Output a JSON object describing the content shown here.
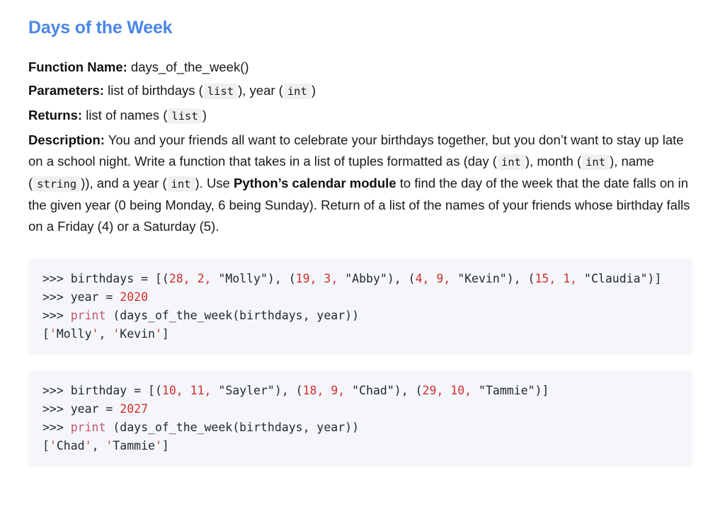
{
  "heading": "Days of the Week",
  "spec": {
    "function_name_label": "Function Name:",
    "function_name_value": "days_of_the_week()",
    "parameters_label": "Parameters:",
    "parameters_text_1": "list of birthdays (",
    "parameters_code_1": "list",
    "parameters_text_2": "), year (",
    "parameters_code_2": "int",
    "parameters_text_3": ")",
    "returns_label": "Returns:",
    "returns_text_1": "list of names (",
    "returns_code_1": "list",
    "returns_text_2": ")"
  },
  "description": {
    "label": "Description:",
    "part_1": "You and your friends all want to celebrate your birthdays together, but you don’t want to stay up late on a school night. Write a function that takes in a list of tuples formatted as (day (",
    "code_1": "int",
    "part_2": "), month (",
    "code_2": "int",
    "part_3": "), name (",
    "code_3": "string",
    "part_4": ")), and a year (",
    "code_4": "int",
    "part_5": "). Use ",
    "bold_1": "Python’s calendar module",
    "part_6": " to find the day of the week that the date falls on in the given year (0 being Monday, 6 being Sunday). Return of a list of the names of your friends whose birthday falls on a Friday (4) or a Saturday (5)."
  },
  "code_blocks": [
    {
      "id": "block-1",
      "lines": [
        {
          "tokens": [
            {
              "t": ">>> birthdays = [(",
              "c": "plain"
            },
            {
              "t": "28, ",
              "c": "num"
            },
            {
              "t": "2, ",
              "c": "num"
            },
            {
              "t": "\"Molly\"), (",
              "c": "plain"
            },
            {
              "t": "19, ",
              "c": "num"
            },
            {
              "t": "3, ",
              "c": "num"
            },
            {
              "t": "\"Abby\"), (",
              "c": "plain"
            },
            {
              "t": "4, ",
              "c": "num"
            },
            {
              "t": "9, ",
              "c": "num"
            },
            {
              "t": "\"Kevin\"), (",
              "c": "plain"
            },
            {
              "t": "15, ",
              "c": "num"
            },
            {
              "t": "1, ",
              "c": "num"
            },
            {
              "t": "\"Claudia\")]",
              "c": "plain"
            }
          ]
        },
        {
          "tokens": [
            {
              "t": ">>> year = ",
              "c": "plain"
            },
            {
              "t": "2020",
              "c": "num"
            }
          ]
        },
        {
          "tokens": [
            {
              "t": ">>> ",
              "c": "plain"
            },
            {
              "t": "print",
              "c": "kw"
            },
            {
              "t": " (days_of_the_week(birthdays, year))",
              "c": "plain"
            }
          ]
        },
        {
          "tokens": [
            {
              "t": "[",
              "c": "plain"
            },
            {
              "t": "'",
              "c": "q"
            },
            {
              "t": "Molly",
              "c": "plain"
            },
            {
              "t": "'",
              "c": "q"
            },
            {
              "t": ", ",
              "c": "plain"
            },
            {
              "t": "'",
              "c": "q"
            },
            {
              "t": "Kevin",
              "c": "plain"
            },
            {
              "t": "'",
              "c": "q"
            },
            {
              "t": "]",
              "c": "plain"
            }
          ]
        }
      ]
    },
    {
      "id": "block-2",
      "lines": [
        {
          "tokens": [
            {
              "t": ">>> birthday = [(",
              "c": "plain"
            },
            {
              "t": "10, ",
              "c": "num"
            },
            {
              "t": "11, ",
              "c": "num"
            },
            {
              "t": "\"Sayler\"), (",
              "c": "plain"
            },
            {
              "t": "18, ",
              "c": "num"
            },
            {
              "t": "9, ",
              "c": "num"
            },
            {
              "t": "\"Chad\"), (",
              "c": "plain"
            },
            {
              "t": "29, ",
              "c": "num"
            },
            {
              "t": "10, ",
              "c": "num"
            },
            {
              "t": "\"Tammie\")]",
              "c": "plain"
            }
          ]
        },
        {
          "tokens": [
            {
              "t": ">>> year = ",
              "c": "plain"
            },
            {
              "t": "2027",
              "c": "num"
            }
          ]
        },
        {
          "tokens": [
            {
              "t": ">>> ",
              "c": "plain"
            },
            {
              "t": "print",
              "c": "kw"
            },
            {
              "t": " (days_of_the_week(birthdays, year))",
              "c": "plain"
            }
          ]
        },
        {
          "tokens": [
            {
              "t": "[",
              "c": "plain"
            },
            {
              "t": "'",
              "c": "q"
            },
            {
              "t": "Chad",
              "c": "plain"
            },
            {
              "t": "'",
              "c": "q"
            },
            {
              "t": ", ",
              "c": "plain"
            },
            {
              "t": "'",
              "c": "q"
            },
            {
              "t": "Tammie",
              "c": "plain"
            },
            {
              "t": "'",
              "c": "q"
            },
            {
              "t": "]",
              "c": "plain"
            }
          ]
        }
      ]
    }
  ],
  "colors": {
    "heading": "#4a86e8",
    "code_background": "#f4f6fa",
    "chip_background": "#f0f0f0",
    "number": "#d12d2d",
    "keyword": "#c4546a",
    "text": "#1a1a1a"
  }
}
